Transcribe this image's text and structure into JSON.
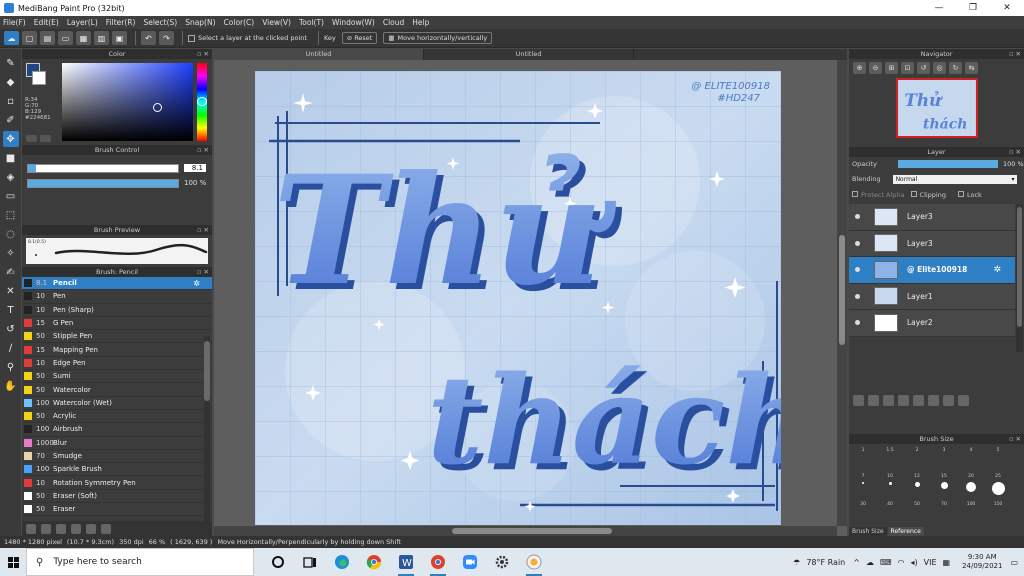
{
  "window": {
    "title": "MediBang Paint Pro (32bit)",
    "minimize": "—",
    "maximize": "❐",
    "close": "✕"
  },
  "menu": [
    "File(F)",
    "Edit(E)",
    "Layer(L)",
    "Filter(R)",
    "Select(S)",
    "Snap(N)",
    "Color(C)",
    "View(V)",
    "Tool(T)",
    "Window(W)",
    "Cloud",
    "Help"
  ],
  "toolbar": {
    "select_layer_label": "Select a layer at the clicked point",
    "key_label": "Key",
    "reset_label": "Reset",
    "move_label": "Move horizontally/vertically"
  },
  "color_panel": {
    "title": "Color",
    "r": "R:34",
    "g": "G:70",
    "b": "B:129",
    "hex": "#224681",
    "fg_color": "#224681"
  },
  "brush_control": {
    "title": "Brush Control",
    "size_value": "8.1",
    "size_fraction": 0.05,
    "opacity_value": "100 %",
    "opacity_fraction": 1.0
  },
  "brush_preview": {
    "title": "Brush Preview",
    "label": "8.1(0.5)"
  },
  "brush_list": {
    "title": "Brush: Pencil",
    "items": [
      {
        "size": "8.1",
        "name": "Pencil",
        "color": "#222222",
        "selected": true
      },
      {
        "size": "10",
        "name": "Pen",
        "color": "#222222"
      },
      {
        "size": "10",
        "name": "Pen (Sharp)",
        "color": "#222222"
      },
      {
        "size": "15",
        "name": "G Pen",
        "color": "#e23b3b"
      },
      {
        "size": "50",
        "name": "Stipple Pen",
        "color": "#f2d21b"
      },
      {
        "size": "15",
        "name": "Mapping Pen",
        "color": "#e23b3b"
      },
      {
        "size": "10",
        "name": "Edge Pen",
        "color": "#e23b3b"
      },
      {
        "size": "50",
        "name": "Sumi",
        "color": "#f2d21b"
      },
      {
        "size": "50",
        "name": "Watercolor",
        "color": "#f2d21b"
      },
      {
        "size": "100",
        "name": "Watercolor (Wet)",
        "color": "#6ec1ff"
      },
      {
        "size": "50",
        "name": "Acrylic",
        "color": "#f2d21b"
      },
      {
        "size": "100",
        "name": "Airbrush",
        "color": "#222222"
      },
      {
        "size": "1000",
        "name": "Blur",
        "color": "#e57ac7"
      },
      {
        "size": "70",
        "name": "Smudge",
        "color": "#e8d3a8"
      },
      {
        "size": "100",
        "name": "Sparkle Brush",
        "color": "#4aa1ff"
      },
      {
        "size": "10",
        "name": "Rotation Symmetry Pen",
        "color": "#e23b3b"
      },
      {
        "size": "50",
        "name": "Eraser (Soft)",
        "color": "#ffffff"
      },
      {
        "size": "50",
        "name": "Eraser",
        "color": "#ffffff"
      }
    ]
  },
  "canvas": {
    "tabs": [
      "Untitled",
      "Untitled"
    ],
    "watermark_handle": "@ ELITE100918",
    "watermark_tag": "#HD247",
    "word1": "Thử",
    "word2": "thách"
  },
  "navigator": {
    "title": "Navigator",
    "thumb_word1": "Thử",
    "thumb_word2": "thách"
  },
  "layer_panel": {
    "title": "Layer",
    "opacity_label": "Opacity",
    "opacity_value": "100 %",
    "blending_label": "Blending",
    "blending_value": "Normal",
    "protect_alpha": "Protect Alpha",
    "clipping": "Clipping",
    "lock": "Lock",
    "layers": [
      {
        "name": "Layer3",
        "selected": false
      },
      {
        "name": "Layer3",
        "selected": false
      },
      {
        "name": "@ Elite100918",
        "selected": true
      },
      {
        "name": "Layer1",
        "selected": false
      },
      {
        "name": "Layer2",
        "selected": false
      }
    ]
  },
  "brush_size": {
    "title": "Brush Size",
    "tab_brush": "Brush Size",
    "tab_reference": "Reference",
    "row1": [
      "1",
      "1.5",
      "2",
      "3",
      "4",
      "5"
    ],
    "row2": [
      "7",
      "10",
      "12",
      "15",
      "20",
      "25"
    ],
    "row3": [
      "30",
      "40",
      "50",
      "70",
      "100",
      "150"
    ]
  },
  "status": {
    "canvas_size": "1480 * 1280 pixel",
    "physical_size": "(10.7 * 9.3cm)",
    "dpi": "350 dpi",
    "zoom": "66 %",
    "cursor": "( 1629, 639 )",
    "hint": "Move Horizontally/Perpendicularly by holding down Shift"
  },
  "taskbar": {
    "search_placeholder": "Type here to search",
    "weather": "78°F Rain",
    "lang": "VIE",
    "time": "9:30 AM",
    "date": "24/09/2021"
  }
}
